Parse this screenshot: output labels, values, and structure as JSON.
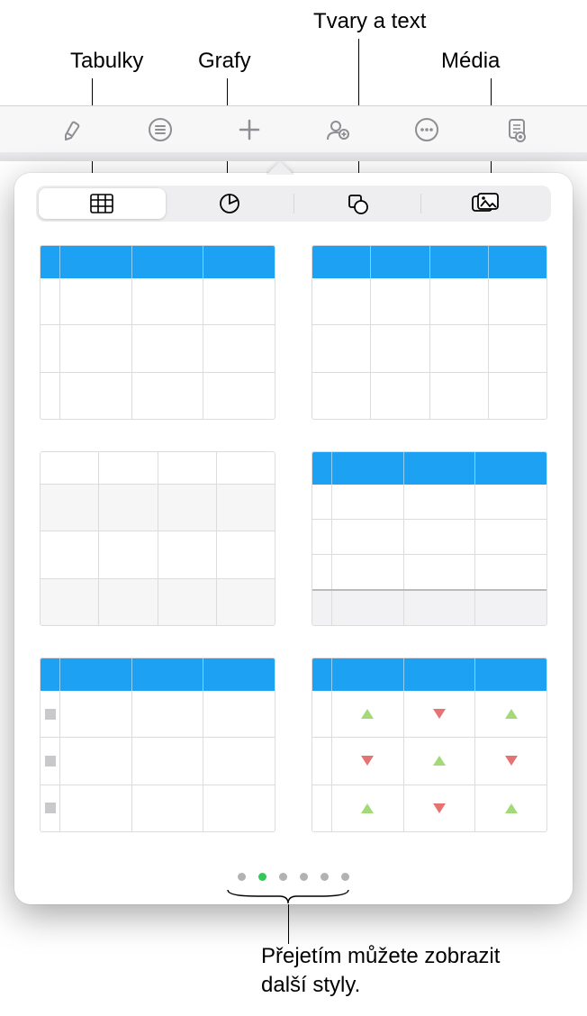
{
  "callouts": {
    "tables": "Tabulky",
    "charts": "Grafy",
    "shapes_text": "Tvary a text",
    "media": "Média",
    "swipe_hint_line1": "Přejetím můžete zobrazit",
    "swipe_hint_line2": "další styly."
  },
  "toolbar": {
    "items": [
      {
        "name": "format-brush-icon"
      },
      {
        "name": "list-circle-icon"
      },
      {
        "name": "add-icon"
      },
      {
        "name": "collaborate-icon"
      },
      {
        "name": "more-icon"
      },
      {
        "name": "document-icon"
      }
    ]
  },
  "popover": {
    "tabs": [
      {
        "name": "tables",
        "icon": "table-icon",
        "active": true
      },
      {
        "name": "charts",
        "icon": "pie-chart-icon",
        "active": false
      },
      {
        "name": "shapes",
        "icon": "shapes-icon",
        "active": false
      },
      {
        "name": "media",
        "icon": "photo-icon",
        "active": false
      }
    ],
    "pager": {
      "count": 6,
      "active_index": 1
    }
  },
  "colors": {
    "accent_blue": "#1DA1F2",
    "pager_active": "#34c759",
    "triangle_up": "#a3d977",
    "triangle_down": "#e57373"
  }
}
